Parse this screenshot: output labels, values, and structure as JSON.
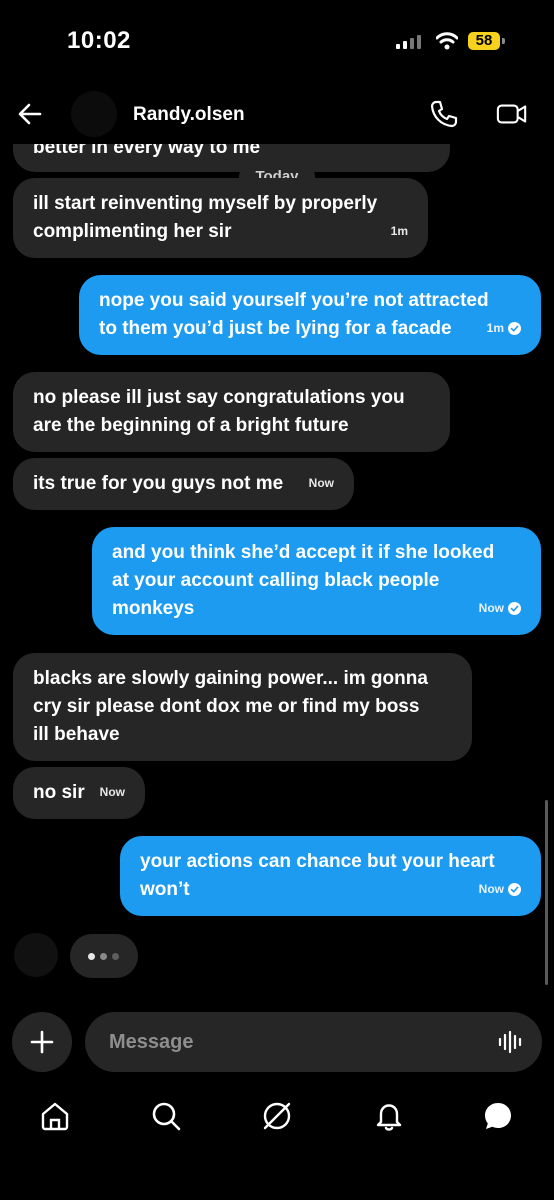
{
  "status_bar": {
    "time": "10:02",
    "battery": "58"
  },
  "header": {
    "username": "Randy.olsen"
  },
  "divider_label": "Today",
  "messages": [
    {
      "dir": "in",
      "text": "better in every way to me",
      "time": ""
    },
    {
      "dir": "in",
      "text": "ill start reinventing myself by properly\ncomplimenting her sir",
      "time": "1m"
    },
    {
      "dir": "out",
      "text": "nope you said yourself you’re not attracted\nto them you’d just be lying for a facade",
      "time": "1m"
    },
    {
      "dir": "in",
      "text": "no please ill just say congratulations you\nare the beginning of a bright future",
      "time": ""
    },
    {
      "dir": "in",
      "text": "its true for you guys not me",
      "time": "Now"
    },
    {
      "dir": "out",
      "text": "and you think she’d accept it if she looked\nat your account calling black people\nmonkeys",
      "time": "Now"
    },
    {
      "dir": "in",
      "text": "blacks are slowly gaining power... im gonna\ncry sir please dont dox me or find my boss\nill behave",
      "time": ""
    },
    {
      "dir": "in",
      "text": "no sir",
      "time": "Now"
    },
    {
      "dir": "out",
      "text": "your actions can chance but your heart\nwon’t",
      "time": "Now"
    }
  ],
  "composer": {
    "placeholder": "Message"
  },
  "icons": {
    "back": "arrow-left-icon",
    "call": "phone-icon",
    "video": "video-camera-icon",
    "plus": "plus-icon",
    "voice": "voice-waveform-icon",
    "nav": [
      "home-icon",
      "search-icon",
      "explore-icon",
      "notifications-bell-icon",
      "messages-bubble-icon"
    ]
  },
  "colors": {
    "outgoing": "#1d9bf0",
    "incoming": "#262626",
    "background": "#000000",
    "battery": "#f6d21e"
  }
}
